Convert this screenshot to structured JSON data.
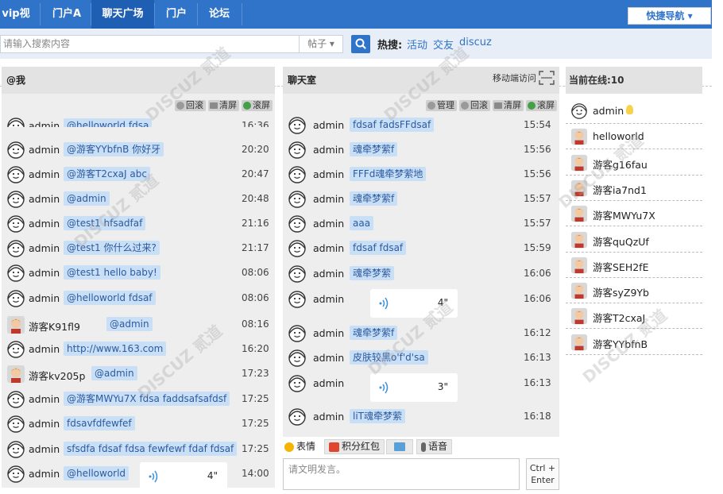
{
  "nav": {
    "items": [
      "vip视频",
      "门户A",
      "聊天广场",
      "门户",
      "论坛"
    ],
    "quick_nav": "快捷导航 ▾"
  },
  "search": {
    "placeholder": "请输入搜索内容",
    "type": "帖子 ▾",
    "hot_label": "热搜:",
    "hot_links": [
      "活动",
      "交友",
      "discuz"
    ]
  },
  "at_me": {
    "title": "@我",
    "toolbar": [
      "回滚",
      "清屏",
      "滚屏"
    ],
    "messages": [
      {
        "user": "admin",
        "text": "@helloworld fdsa",
        "time": "16:36"
      },
      {
        "user": "admin",
        "text": "@游客YYbfnB 你好牙",
        "time": "20:20"
      },
      {
        "user": "admin",
        "text": "@游客T2cxaJ abc",
        "time": "20:47"
      },
      {
        "user": "admin",
        "text": "@admin",
        "time": "20:48"
      },
      {
        "user": "admin",
        "text": "@test1 hfsadfaf",
        "time": "21:16"
      },
      {
        "user": "admin",
        "text": "@test1 你什么过来?",
        "time": "21:17"
      },
      {
        "user": "admin",
        "text": "@test1 hello baby!",
        "time": "08:06"
      },
      {
        "user": "admin",
        "text": "@helloworld fdsaf",
        "time": "08:06"
      },
      {
        "user": "游客K91fl9",
        "text": "@admin",
        "time": "08:16"
      },
      {
        "user": "admin",
        "text": "http://www.163.com",
        "time": "16:20"
      },
      {
        "user": "游客kv205p",
        "text": "@admin",
        "time": "17:23"
      },
      {
        "user": "admin",
        "text": "@游客MWYu7X fdsa faddsafsafdsf",
        "time": "17:25"
      },
      {
        "user": "admin",
        "text": "fdsavfdfewfef",
        "time": "17:25"
      },
      {
        "user": "admin",
        "text": "sfsdfa fdsaf fdsa fewfewf fdaf fdsaf",
        "time": "17:25"
      },
      {
        "user": "admin",
        "text": "@helloworld",
        "time": "14:00",
        "voice": "4\""
      }
    ]
  },
  "chatroom": {
    "title": "聊天室",
    "mobile_label": "移动端访问",
    "toolbar": [
      "管理",
      "回滚",
      "清屏",
      "滚屏"
    ],
    "messages": [
      {
        "user": "admin",
        "text": "fdsaf fadsFFdsaf",
        "time": "15:54"
      },
      {
        "user": "admin",
        "text": "魂牵梦萦f",
        "time": "15:56"
      },
      {
        "user": "admin",
        "text": "FFFd魂牵梦萦地",
        "time": "15:56"
      },
      {
        "user": "admin",
        "text": "魂牵梦萦f",
        "time": "15:57"
      },
      {
        "user": "admin",
        "text": "aaa",
        "time": "15:57"
      },
      {
        "user": "admin",
        "text": "fdsaf fdsaf",
        "time": "15:59"
      },
      {
        "user": "admin",
        "text": "魂牵梦萦",
        "time": "16:06"
      },
      {
        "user": "admin",
        "voice": "4\"",
        "time": "16:06"
      },
      {
        "user": "admin",
        "text": "魂牵梦萦f",
        "time": "16:12"
      },
      {
        "user": "admin",
        "text": "皮肤较黑o'f'd'sa",
        "time": "16:13"
      },
      {
        "user": "admin",
        "voice": "3\"",
        "time": "16:13"
      },
      {
        "user": "admin",
        "text": "liT魂牵梦萦",
        "time": "16:18"
      }
    ],
    "actions": [
      "表情",
      "积分红包",
      "",
      "语音"
    ],
    "input_placeholder": "请文明发言。",
    "send_line1": "Ctrl +",
    "send_line2": "Enter"
  },
  "online": {
    "title": "当前在线:10",
    "users": [
      "admin",
      "helloworld",
      "游客g16fau",
      "游客ia7nd1",
      "游客MWYu7X",
      "游客quQzUf",
      "游客SEH2fE",
      "游客syZ9Yb",
      "游客T2cxaJ",
      "游客YYbfnB"
    ]
  },
  "colors": {
    "nav": "#2f74c9",
    "bubble": "#c9dff6",
    "panel": "#eeeeee"
  }
}
